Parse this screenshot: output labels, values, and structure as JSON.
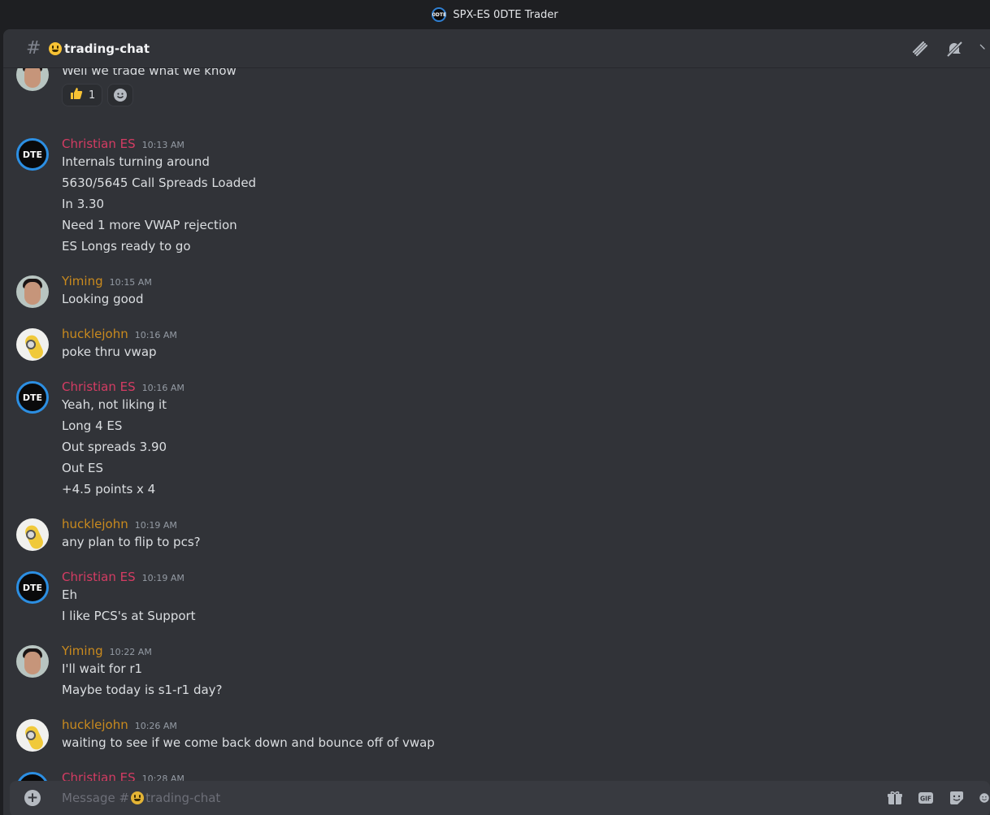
{
  "window": {
    "title": "SPX-ES 0DTE Trader",
    "logo_text": "0DTE"
  },
  "header": {
    "hash": "#",
    "channel": "trading-chat"
  },
  "messages": [
    {
      "type": "continuation",
      "lines": [
        "Well we trade what we know"
      ],
      "reactions": [
        {
          "emoji": "thumbs-up",
          "count": "1"
        }
      ]
    },
    {
      "author": "Christian ES",
      "time": "10:13 AM",
      "lines": [
        "Internals turning around",
        "5630/5645 Call Spreads Loaded",
        "In 3.30",
        "Need 1 more VWAP rejection",
        "ES Longs ready to go"
      ]
    },
    {
      "author": "Yiming",
      "time": "10:15 AM",
      "lines": [
        "Looking good"
      ]
    },
    {
      "author": "hucklejohn",
      "time": "10:16 AM",
      "lines": [
        "poke thru vwap"
      ]
    },
    {
      "author": "Christian ES",
      "time": "10:16 AM",
      "lines": [
        "Yeah, not liking it",
        "Long 4 ES",
        "Out spreads 3.90",
        "Out ES",
        "+4.5 points x 4"
      ]
    },
    {
      "author": "hucklejohn",
      "time": "10:19 AM",
      "lines": [
        "any plan to flip to pcs?"
      ]
    },
    {
      "author": "Christian ES",
      "time": "10:19 AM",
      "lines": [
        "Eh",
        "I like PCS's at Support"
      ]
    },
    {
      "author": "Yiming",
      "time": "10:22 AM",
      "lines": [
        "I'll wait for r1",
        "Maybe today is s1-r1 day?"
      ]
    },
    {
      "author": "hucklejohn",
      "time": "10:26 AM",
      "lines": [
        "waiting to see if we come back down and bounce off of vwap"
      ]
    },
    {
      "author": "Christian ES",
      "time": "10:28 AM",
      "lines": []
    }
  ],
  "composer": {
    "placeholder_prefix": "Message #",
    "placeholder_channel": "trading-chat",
    "gif_label": "GIF"
  },
  "colors": {
    "christian": "#d43c63",
    "yiming": "#c98a1e",
    "hucklejohn": "#c98a1e",
    "background": "#313338"
  }
}
